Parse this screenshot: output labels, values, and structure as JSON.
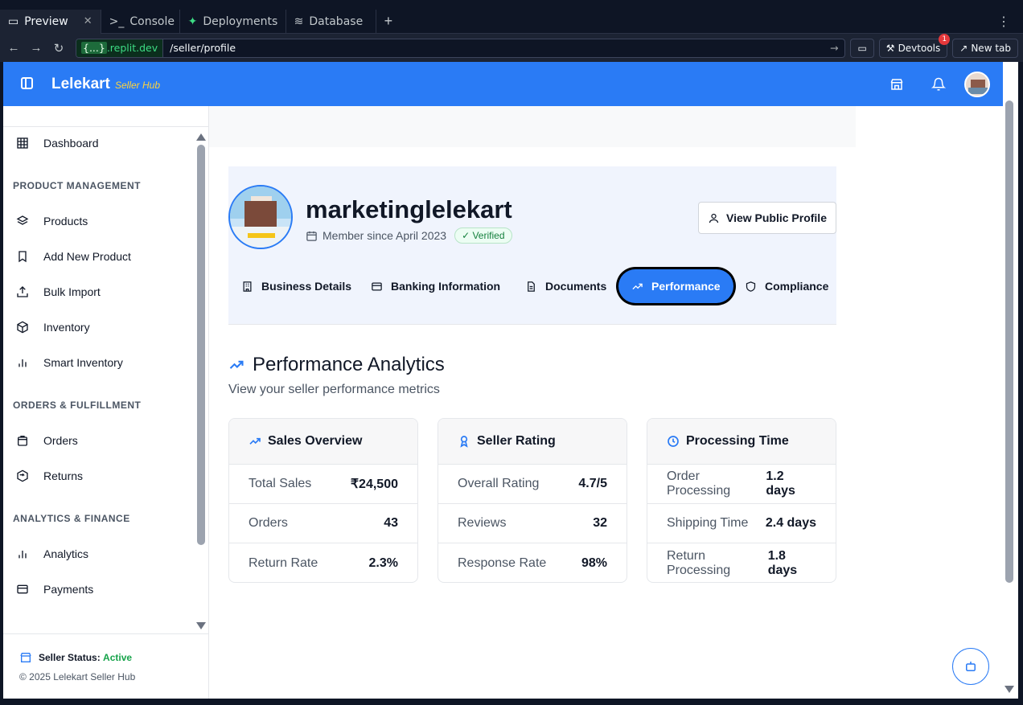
{
  "browser": {
    "tabs": [
      {
        "label": "Preview",
        "icon": "monitor-icon"
      },
      {
        "label": "Console",
        "icon": "terminal-icon"
      },
      {
        "label": "Deployments",
        "icon": "deploy-icon"
      },
      {
        "label": "Database",
        "icon": "database-icon"
      }
    ],
    "url_host": "{...}.replit.dev",
    "url_host_badge": "{...}",
    "url_host_rest": ".replit.dev",
    "url_path": "/seller/profile",
    "devtools_label": "Devtools",
    "devtools_badge": "1",
    "newtab_label": "New tab"
  },
  "header": {
    "brand": "Lelekart",
    "brand_sub": "Seller Hub"
  },
  "sidebar": {
    "dashboard": "Dashboard",
    "sections": [
      {
        "title": "PRODUCT MANAGEMENT",
        "items": [
          "Products",
          "Add New Product",
          "Bulk Import",
          "Inventory",
          "Smart Inventory"
        ]
      },
      {
        "title": "ORDERS & FULFILLMENT",
        "items": [
          "Orders",
          "Returns"
        ]
      },
      {
        "title": "ANALYTICS & FINANCE",
        "items": [
          "Analytics",
          "Payments"
        ]
      }
    ],
    "status_label": "Seller Status:",
    "status_value": "Active",
    "copyright": "© 2025 Lelekart Seller Hub"
  },
  "profile": {
    "name": "marketinglelekart",
    "member_since": "Member since April 2023",
    "verified": "Verified",
    "view_public": "View Public Profile",
    "tabs": [
      "Business Details",
      "Banking Information",
      "Documents",
      "Performance",
      "Compliance"
    ],
    "active_tab": "Performance"
  },
  "analytics": {
    "title": "Performance Analytics",
    "subtitle": "View your seller performance metrics",
    "cards": [
      {
        "title": "Sales Overview",
        "rows": [
          {
            "k": "Total Sales",
            "v": "₹24,500"
          },
          {
            "k": "Orders",
            "v": "43"
          },
          {
            "k": "Return Rate",
            "v": "2.3%"
          }
        ]
      },
      {
        "title": "Seller Rating",
        "rows": [
          {
            "k": "Overall Rating",
            "v": "4.7/5"
          },
          {
            "k": "Reviews",
            "v": "32"
          },
          {
            "k": "Response Rate",
            "v": "98%"
          }
        ]
      },
      {
        "title": "Processing Time",
        "rows": [
          {
            "k": "Order Processing",
            "v": "1.2 days"
          },
          {
            "k": "Shipping Time",
            "v": "2.4 days"
          },
          {
            "k": "Return Processing",
            "v": "1.8 days"
          }
        ]
      }
    ]
  },
  "colors": {
    "brand_blue": "#2a7bf5",
    "active_green": "#16a34a",
    "brand_sub_yellow": "#ffd43b"
  }
}
